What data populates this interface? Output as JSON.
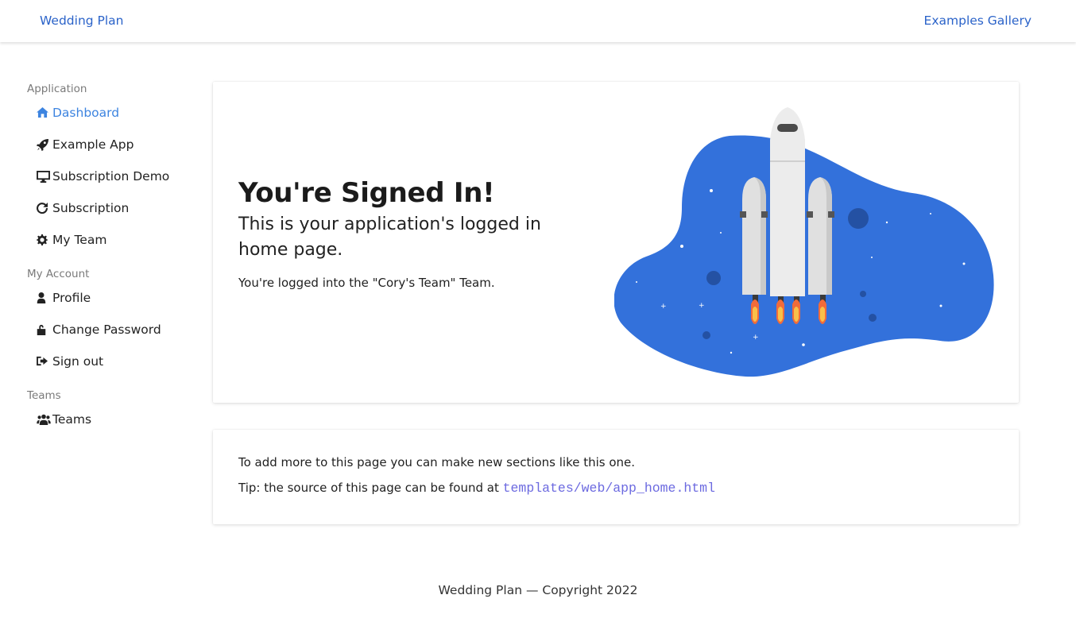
{
  "nav": {
    "brand": "Wedding Plan",
    "gallery": "Examples Gallery"
  },
  "sidebar": {
    "sections": [
      {
        "label": "Application",
        "items": [
          {
            "label": "Dashboard",
            "icon": "home-icon",
            "active": true
          },
          {
            "label": "Example App",
            "icon": "rocket-icon"
          },
          {
            "label": "Subscription Demo",
            "icon": "monitor-icon"
          },
          {
            "label": "Subscription",
            "icon": "refresh-icon"
          },
          {
            "label": "My Team",
            "icon": "gear-icon"
          }
        ]
      },
      {
        "label": "My Account",
        "items": [
          {
            "label": "Profile",
            "icon": "user-icon"
          },
          {
            "label": "Change Password",
            "icon": "unlock-icon"
          },
          {
            "label": "Sign out",
            "icon": "sign-out-icon"
          }
        ]
      },
      {
        "label": "Teams",
        "items": [
          {
            "label": "Teams",
            "icon": "users-icon"
          }
        ]
      }
    ]
  },
  "hero": {
    "title": "You're Signed In!",
    "subtitle": "This is your application's logged in home page.",
    "team_text": "You're logged into the \"Cory's Team\" Team."
  },
  "info": {
    "line1": "To add more to this page you can make new sections like this one.",
    "tip_prefix": "Tip: the source of this page can be found at",
    "tip_path": "templates/web/app_home.html"
  },
  "footer": {
    "text": "Wedding Plan — Copyright 2022"
  },
  "colors": {
    "accent": "#3d84e0",
    "link": "#2b63c9",
    "code": "#6c6ae0",
    "blob": "#3371db"
  }
}
